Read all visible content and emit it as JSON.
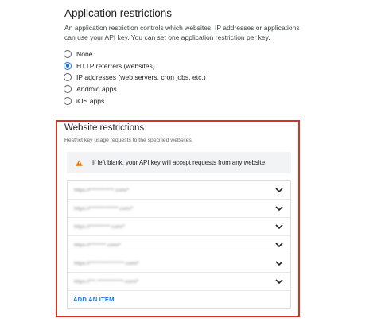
{
  "app_restrictions": {
    "title": "Application restrictions",
    "description": "An application restriction controls which websites, IP addresses or applications can use your API key. You can set one application restriction per key.",
    "options": [
      {
        "label": "None",
        "checked": false
      },
      {
        "label": "HTTP referrers (websites)",
        "checked": true
      },
      {
        "label": "IP addresses (web servers, cron jobs, etc.)",
        "checked": false
      },
      {
        "label": "Android apps",
        "checked": false
      },
      {
        "label": "iOS apps",
        "checked": false
      }
    ]
  },
  "website_restrictions": {
    "title": "Website restrictions",
    "subtitle": "Restrict key usage requests to the specified websites.",
    "warning": "If left blank, your API key will accept requests from any website.",
    "items": [
      "https://************.com/*",
      "https://**************.com/*",
      "https://**********.com/*",
      "https://********.com/*",
      "https://*****************.com/*",
      "https://***.*************.com/*"
    ],
    "add_label": "ADD AN ITEM"
  },
  "colors": {
    "accent": "#1a73e8",
    "highlight": "#d93025",
    "warning": "#e37400"
  },
  "icons": {
    "warning": "warning-triangle-icon",
    "expand": "chevron-down-icon"
  }
}
